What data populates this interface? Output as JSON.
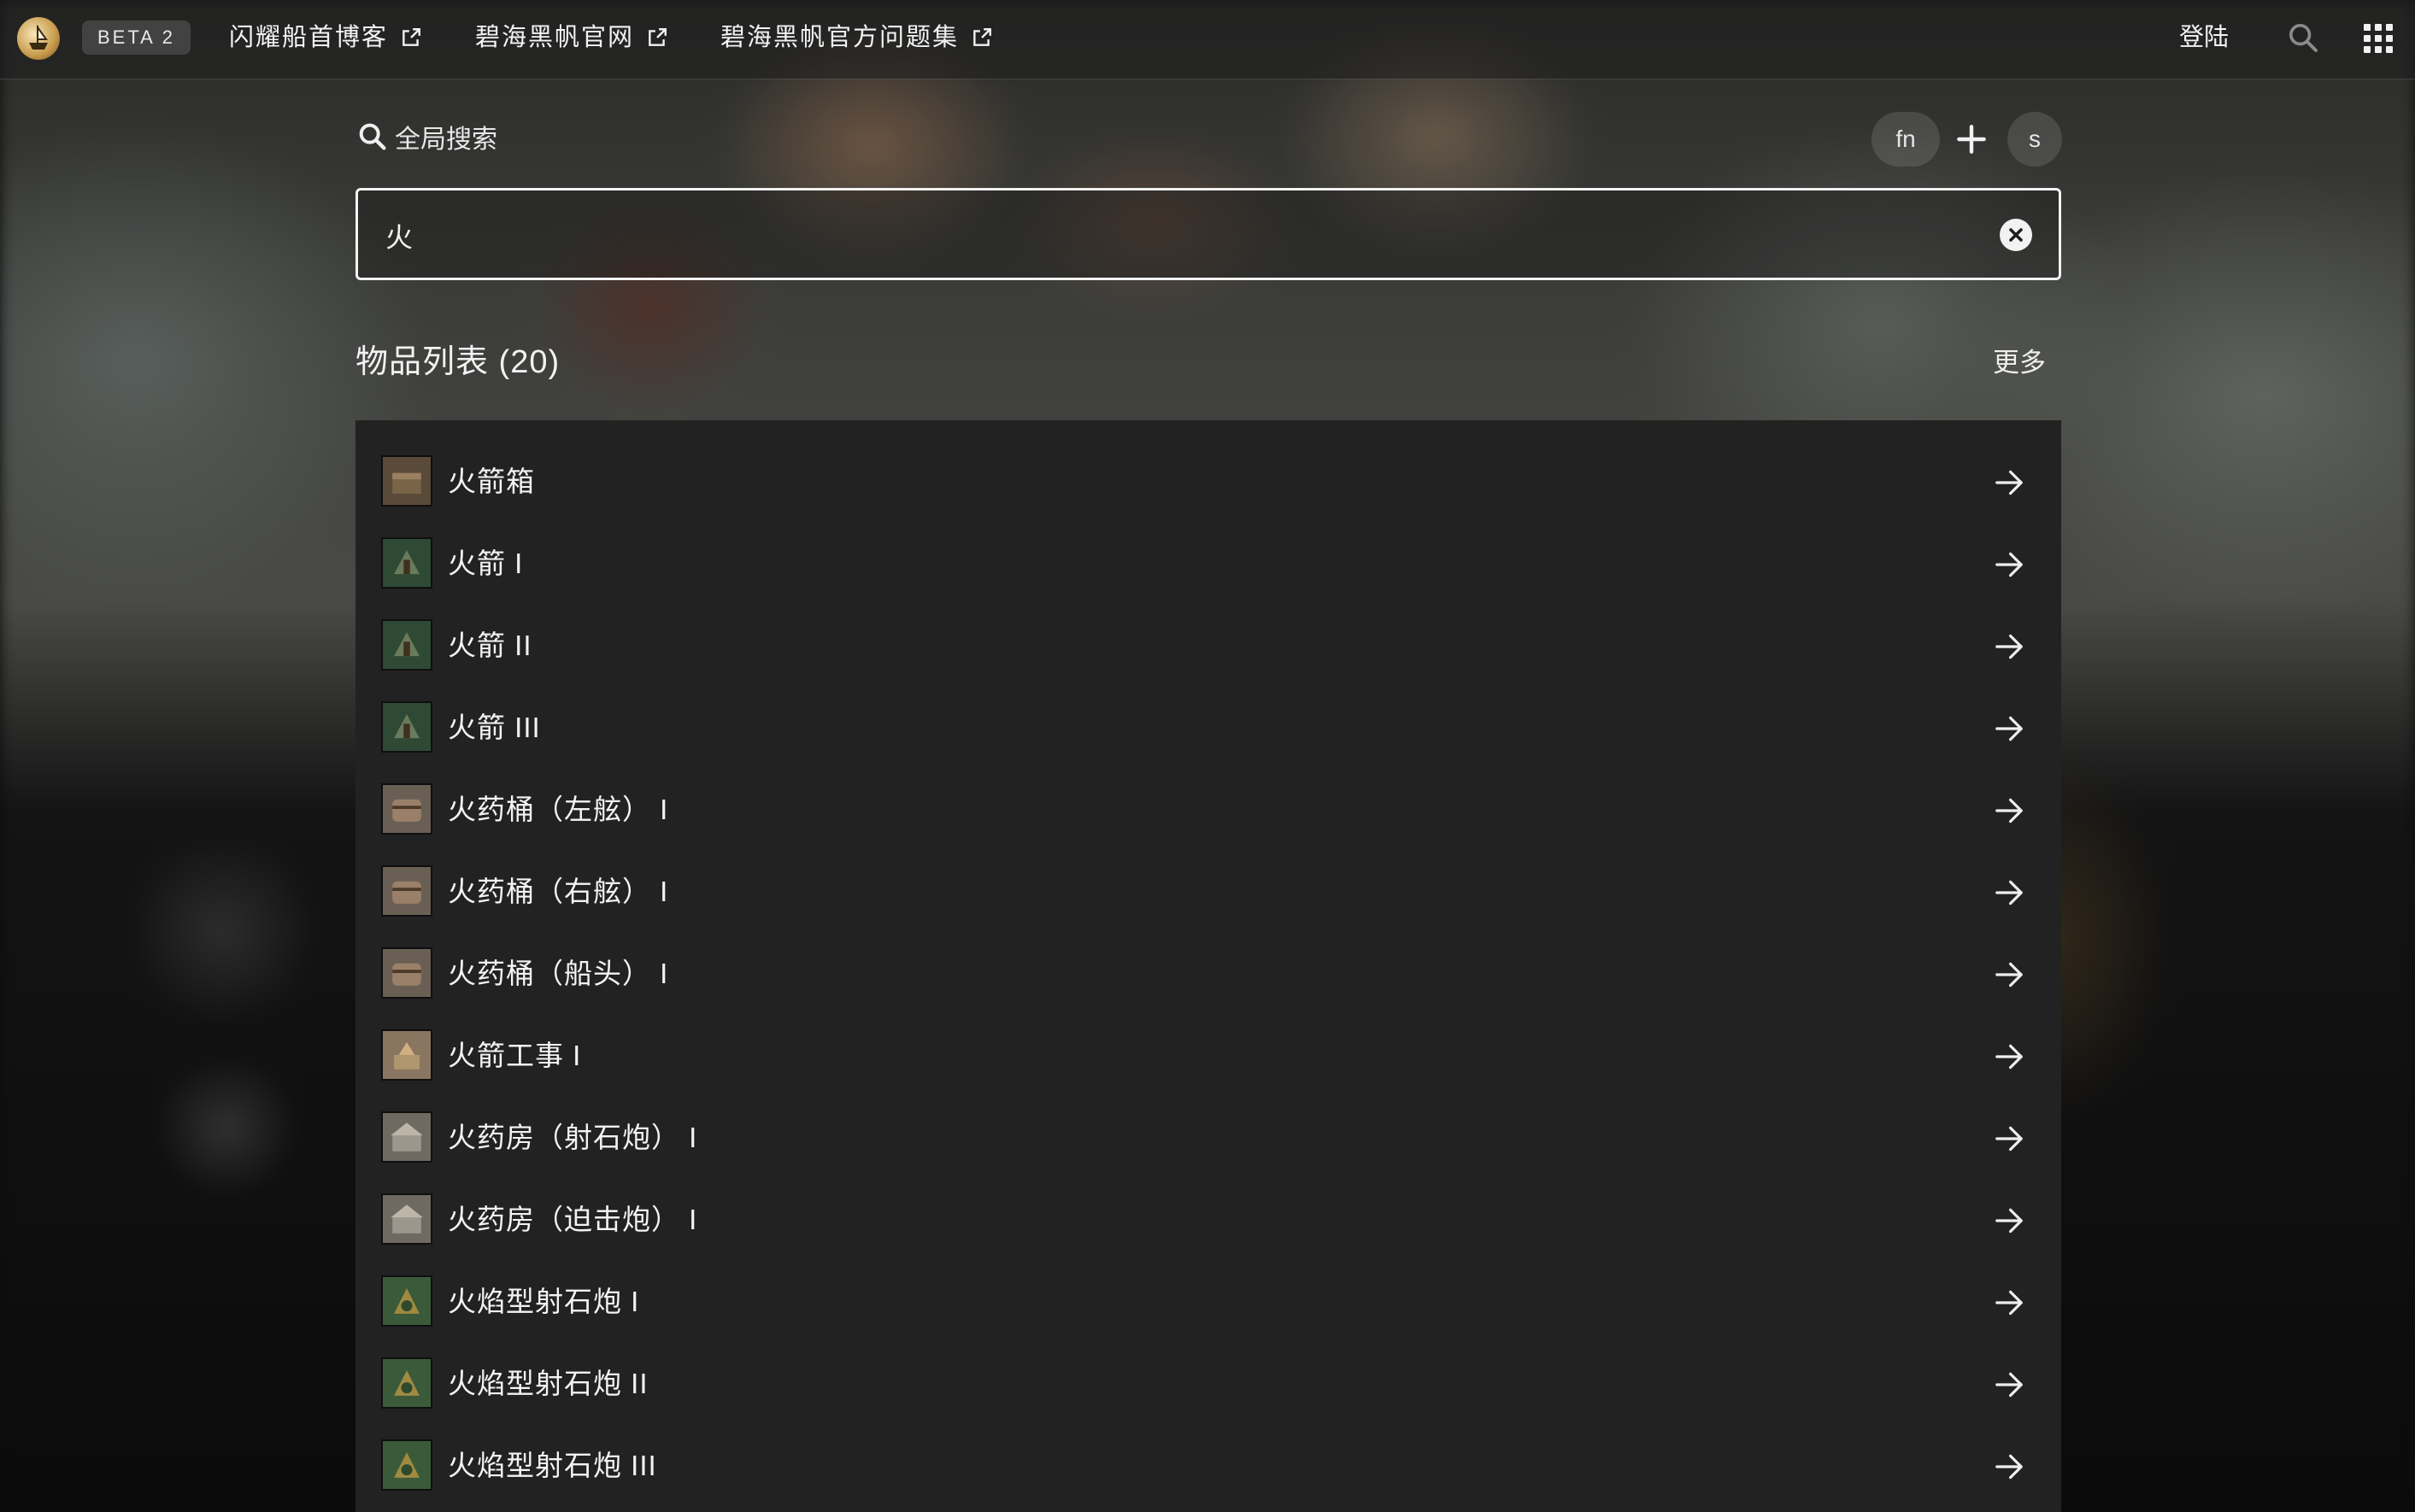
{
  "topbar": {
    "badge": "BETA 2",
    "links": [
      {
        "label": "闪耀船首博客",
        "icon": "external-link-icon"
      },
      {
        "label": "碧海黑帆官网",
        "icon": "external-link-icon"
      },
      {
        "label": "碧海黑帆官方问题集",
        "icon": "external-link-icon"
      }
    ],
    "login": "登陆"
  },
  "search": {
    "heading": "全局搜索",
    "fn_label": "fn",
    "s_label": "s",
    "value": "火"
  },
  "results": {
    "title": "物品列表 (20)",
    "more": "更多",
    "items": [
      {
        "label": "火箭箱",
        "thumb": "crate"
      },
      {
        "label": "火箭 I",
        "thumb": "rocket"
      },
      {
        "label": "火箭 II",
        "thumb": "rocket"
      },
      {
        "label": "火箭 III",
        "thumb": "rocket"
      },
      {
        "label": "火药桶（左舷） I",
        "thumb": "barrel"
      },
      {
        "label": "火药桶（右舷） I",
        "thumb": "barrel"
      },
      {
        "label": "火药桶（船头） I",
        "thumb": "barrel"
      },
      {
        "label": "火箭工事 I",
        "thumb": "fort"
      },
      {
        "label": "火药房（射石炮） I",
        "thumb": "house"
      },
      {
        "label": "火药房（迫击炮） I",
        "thumb": "house"
      },
      {
        "label": "火焰型射石炮 I",
        "thumb": "cannon"
      },
      {
        "label": "火焰型射石炮 II",
        "thumb": "cannon"
      },
      {
        "label": "火焰型射石炮 III",
        "thumb": "cannon"
      }
    ]
  },
  "colors": {
    "crate": "#5a4a3a",
    "rocket": "#2f4a34",
    "barrel": "#6a5f55",
    "fort": "#8a7660",
    "house": "#6e6a62",
    "cannon": "#3b5a3a"
  }
}
